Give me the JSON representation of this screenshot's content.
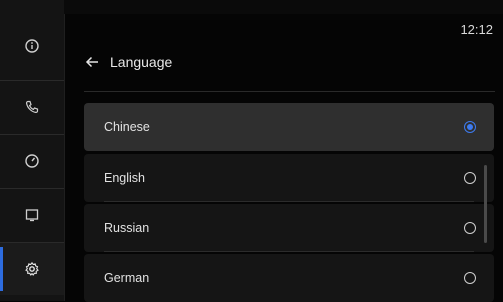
{
  "status_bar": {
    "time": "12:12"
  },
  "sidebar": {
    "items": [
      {
        "icon": "info-icon"
      },
      {
        "icon": "phone-icon"
      },
      {
        "icon": "gauge-icon"
      },
      {
        "icon": "display-icon"
      },
      {
        "icon": "settings-icon",
        "active": true
      }
    ]
  },
  "header": {
    "back_icon": "arrow-left-icon",
    "title": "Language"
  },
  "languages": [
    {
      "label": "Chinese",
      "selected": true
    },
    {
      "label": "English",
      "selected": false
    },
    {
      "label": "Russian",
      "selected": false
    },
    {
      "label": "German",
      "selected": false
    }
  ],
  "colors": {
    "accent": "#3d7bf0",
    "background": "#050505",
    "selected_row": "#2f2f2f"
  }
}
